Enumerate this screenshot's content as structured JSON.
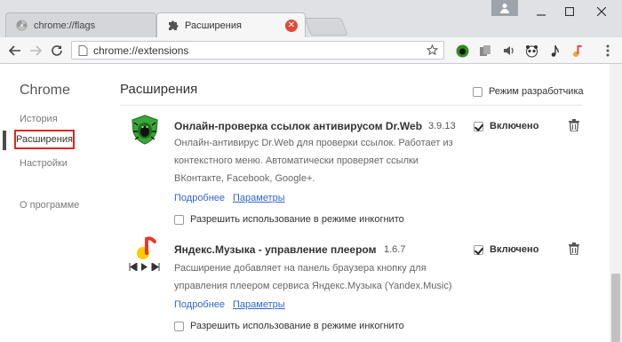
{
  "tabs": [
    {
      "label": "chrome://flags",
      "icon": "radiation-icon"
    },
    {
      "label": "Расширения",
      "icon": "puzzle-icon"
    }
  ],
  "toolbar": {
    "url": "chrome://extensions"
  },
  "sidebar": {
    "title": "Chrome",
    "items": [
      "История",
      "Расширения",
      "Настройки",
      "О программе"
    ]
  },
  "main": {
    "title": "Расширения",
    "dev_mode_label": "Режим разработчика"
  },
  "extensions": [
    {
      "name": "Онлайн-проверка ссылок антивирусом Dr.Web",
      "version": "3.9.13",
      "description_lines": [
        "Онлайн-антивирус Dr.Web для проверки ссылок. Работает из",
        "контекстного меню. Автоматически проверяет ссылки",
        "ВКонтакте, Facebook, Google+."
      ],
      "details_link": "Подробнее",
      "params_link": "Параметры",
      "incognito_label": "Разрешить использование в режиме инкогнито",
      "enabled_label": "Включено"
    },
    {
      "name": "Яндекс.Музыка - управление плеером",
      "version": "1.6.7",
      "description_lines": [
        "Расширение добавляет на панель браузера кнопку для",
        "управления плеером сервиса Яндекс.Музыка (Yandex.Music)"
      ],
      "details_link": "Подробнее",
      "params_link": "Параметры",
      "incognito_label": "Разрешить использование в режиме инкогнито",
      "enabled_label": "Включено"
    }
  ]
}
